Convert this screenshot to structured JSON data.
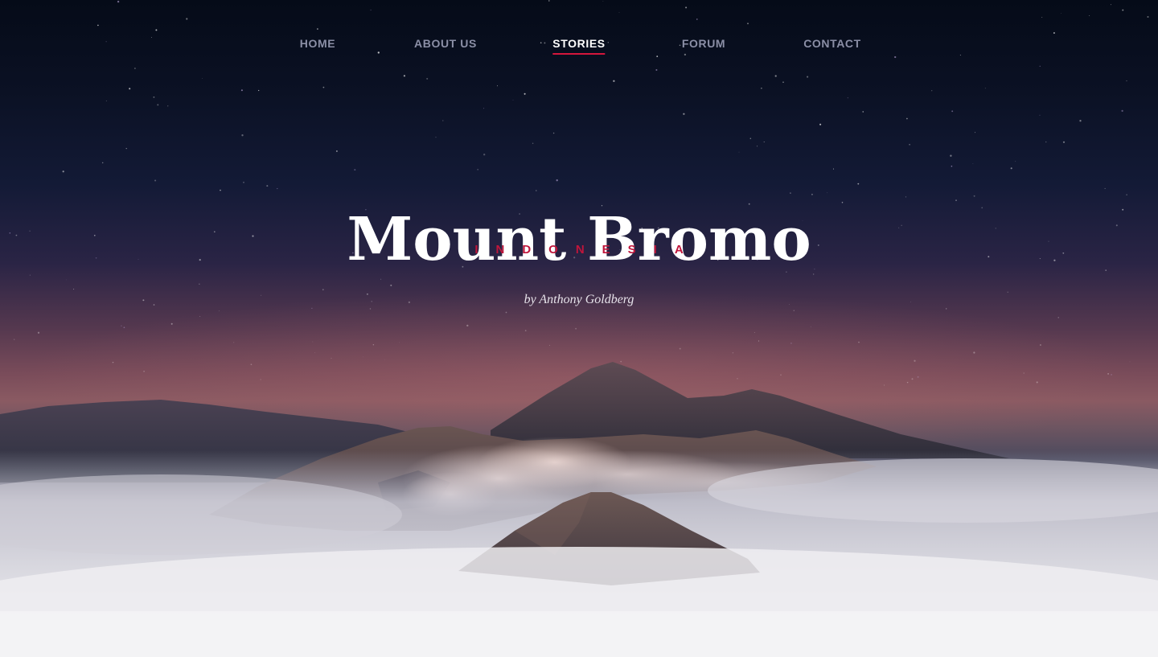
{
  "nav": {
    "items": [
      {
        "label": "HOME",
        "active": false
      },
      {
        "label": "ABOUT US",
        "active": false
      },
      {
        "label": "STORIES",
        "active": true
      },
      {
        "label": "FORUM",
        "active": false
      },
      {
        "label": "CONTACT",
        "active": false
      }
    ]
  },
  "hero": {
    "title": "Mount Bromo",
    "subtitle": "INDONESIA",
    "byline": "by Anthony Goldberg"
  },
  "colors": {
    "accent": "#d4163c",
    "nav_text": "#8b8fa6",
    "nav_active": "#ffffff",
    "sky_top": "#050b18",
    "sky_horizon": "#8a5a62",
    "fog": "#ececef"
  }
}
